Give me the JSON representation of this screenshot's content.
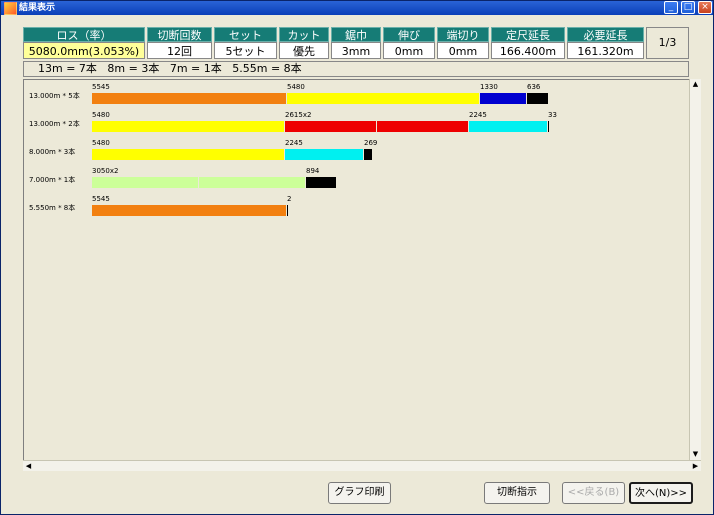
{
  "window": {
    "title": "結果表示",
    "min": "_",
    "max": "□",
    "close": "×"
  },
  "header": {
    "labels": [
      "ロス（率）",
      "切断回数",
      "セット",
      "カット",
      "鋸巾",
      "伸び",
      "端切り",
      "定尺延長",
      "必要延長"
    ],
    "values": [
      "5080.0mm(3.053%)",
      "12回",
      "5セット",
      "優先",
      "3mm",
      "0mm",
      "0mm",
      "166.400m",
      "161.320m"
    ],
    "page": "1/3"
  },
  "summary": "13m = 7本   8m = 3本   7m = 1本   5.55m = 8本",
  "colors": {
    "orange": "#f28010",
    "yellow": "#ffff00",
    "blue": "#0000d0",
    "black": "#000000",
    "red": "#ee0000",
    "cyan": "#00f0f0",
    "lightgreen": "#ccff99"
  },
  "rows": [
    {
      "label": "13.000m * 5本",
      "segments": [
        {
          "label": "5545",
          "color": "orange",
          "length": 5545
        },
        {
          "label": "5480",
          "color": "yellow",
          "length": 5480
        },
        {
          "label": "1330",
          "color": "blue",
          "length": 1330
        },
        {
          "label": "636",
          "color": "black",
          "length": 636
        }
      ]
    },
    {
      "label": "13.000m * 2本",
      "segments": [
        {
          "label": "5480",
          "color": "yellow",
          "length": 5480
        },
        {
          "label": "2615x2",
          "color": "red",
          "length": 2615
        },
        {
          "label": "",
          "color": "red",
          "length": 2615
        },
        {
          "label": "2245",
          "color": "cyan",
          "length": 2245
        },
        {
          "label": "33",
          "color": "black",
          "length": 33
        }
      ]
    },
    {
      "label": "8.000m * 3本",
      "segments": [
        {
          "label": "5480",
          "color": "yellow",
          "length": 5480
        },
        {
          "label": "2245",
          "color": "cyan",
          "length": 2245
        },
        {
          "label": "269",
          "color": "black",
          "length": 269
        }
      ]
    },
    {
      "label": "7.000m * 1本",
      "segments": [
        {
          "label": "3050x2",
          "color": "lightgreen",
          "length": 3050
        },
        {
          "label": "",
          "color": "lightgreen",
          "length": 3050
        },
        {
          "label": "894",
          "color": "black",
          "length": 894
        }
      ]
    },
    {
      "label": "5.550m * 8本",
      "segments": [
        {
          "label": "5545",
          "color": "orange",
          "length": 5545
        },
        {
          "label": "2",
          "color": "black",
          "length": 2
        }
      ]
    }
  ],
  "buttons": {
    "graph_print": "グラフ印刷",
    "cut_instructions": "切断指示",
    "back": "<<戻る(B)",
    "next": "次へ(N)>>"
  },
  "scroll": {
    "up": "▲",
    "down": "▼",
    "left": "◀",
    "right": "▶"
  }
}
